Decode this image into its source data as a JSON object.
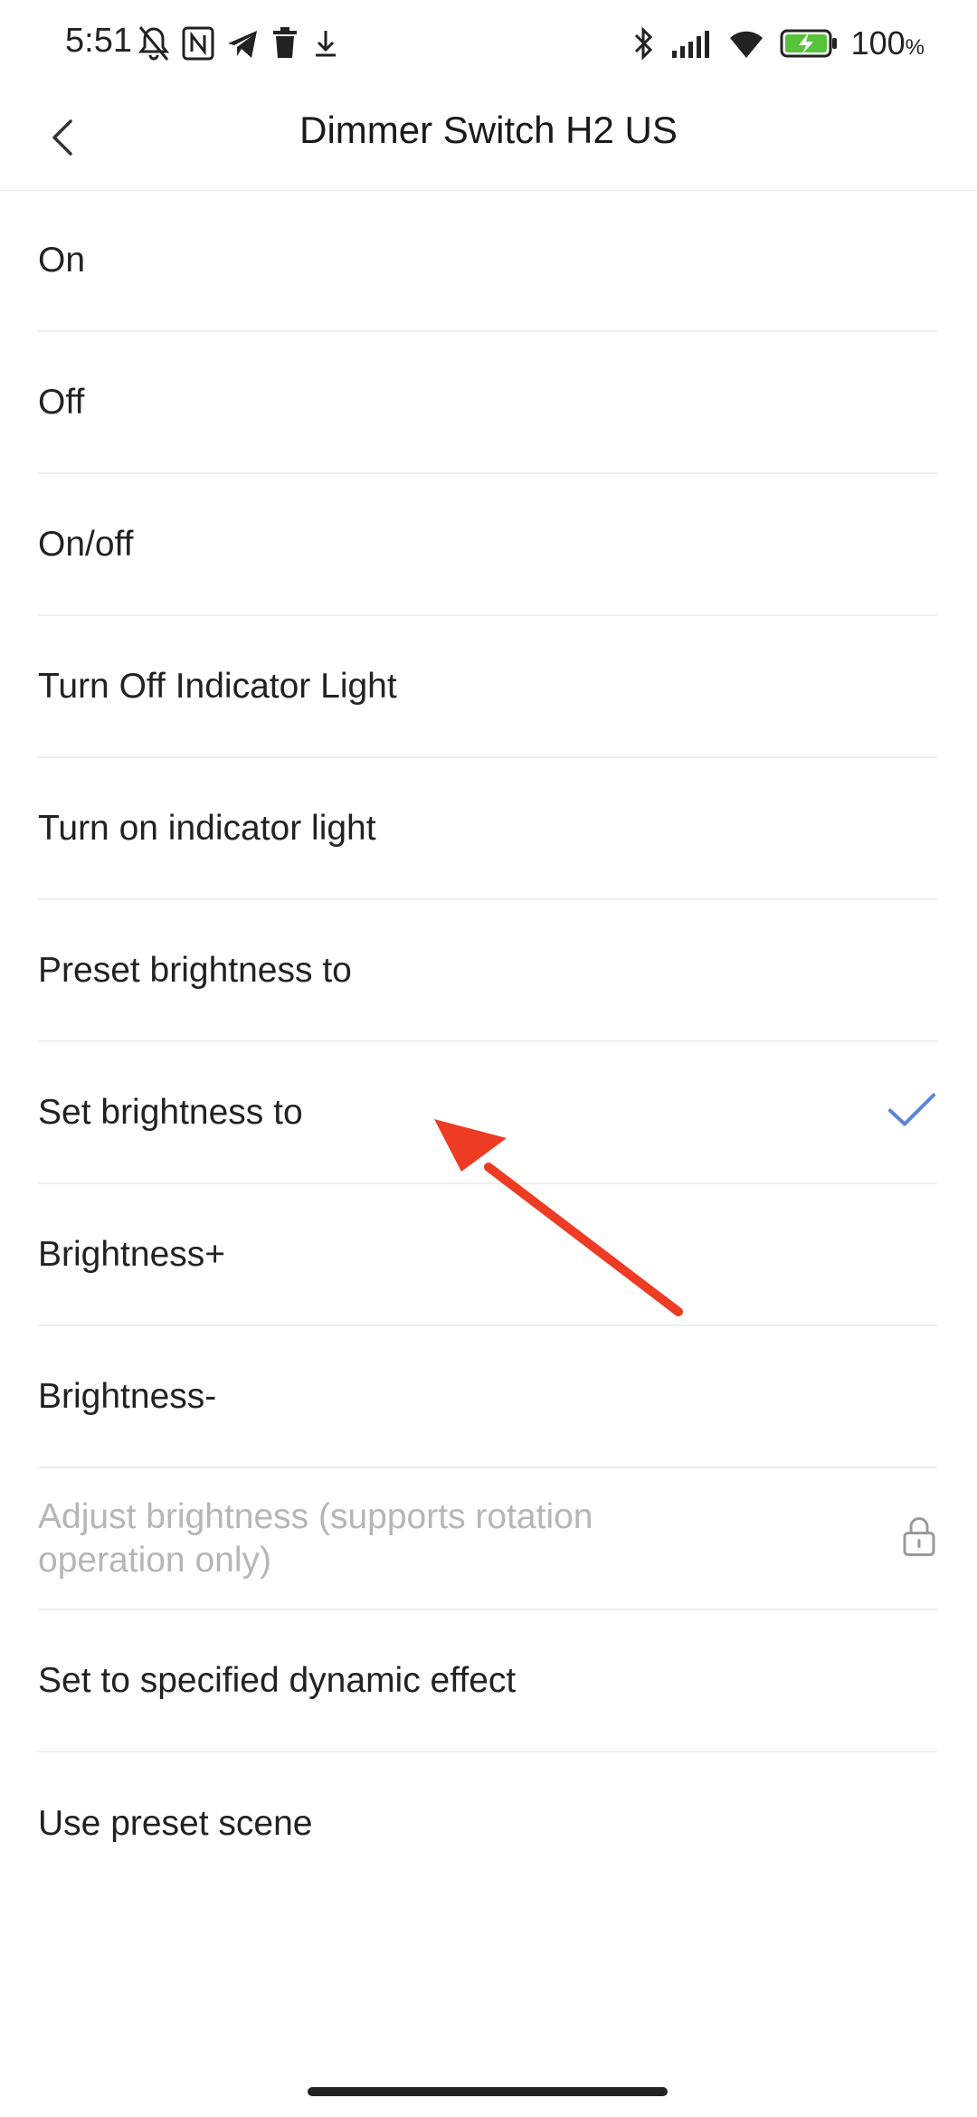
{
  "status_bar": {
    "time": "5:51",
    "battery_percent": "100",
    "battery_unit": "%",
    "icons_left": [
      "mute-bell-icon",
      "nfc-icon",
      "telegram-icon",
      "trash-icon",
      "download-icon"
    ],
    "icons_right": [
      "bluetooth-icon",
      "signal-icon",
      "wifi-icon",
      "battery-charging-icon"
    ],
    "battery_color": "#57c23a"
  },
  "header": {
    "title": "Dimmer Switch H2 US",
    "back_icon": "chevron-left-icon"
  },
  "actions": [
    {
      "label": "On"
    },
    {
      "label": "Off"
    },
    {
      "label": "On/off"
    },
    {
      "label": "Turn Off Indicator Light"
    },
    {
      "label": "Turn on indicator light"
    },
    {
      "label": "Preset brightness to"
    },
    {
      "label": "Set brightness to",
      "selected": true
    },
    {
      "label": "Brightness+"
    },
    {
      "label": "Brightness-"
    },
    {
      "label": "Adjust brightness (supports rotation operation only)",
      "locked": true
    },
    {
      "label": "Set to specified dynamic effect"
    },
    {
      "label": "Use preset scene"
    }
  ],
  "colors": {
    "check": "#5b86d6",
    "disabled_text": "#b6b6b6",
    "annotation_arrow": "#ee3b24"
  }
}
